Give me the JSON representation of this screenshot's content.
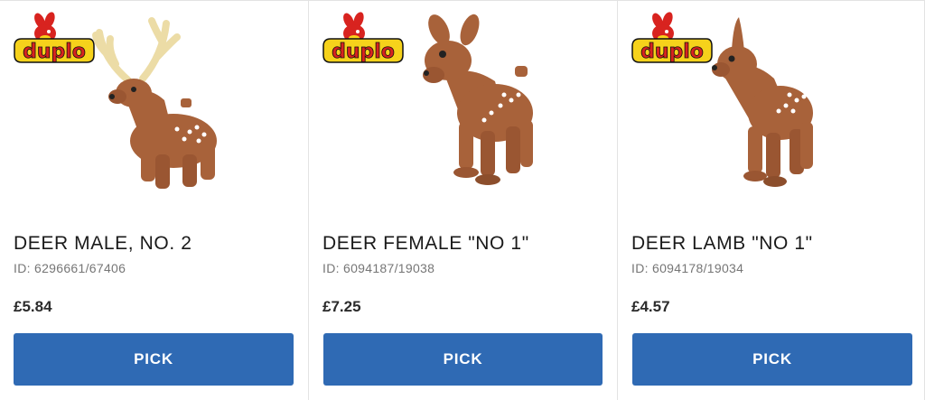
{
  "brand": {
    "logo_text": "duplo",
    "colors": {
      "logo_red": "#d8231f",
      "logo_yellow": "#f6d21b",
      "deer_brown": "#a8623a",
      "antler_cream": "#ecdca6",
      "button_blue": "#2f6ab4"
    }
  },
  "products": [
    {
      "name": "DEER MALE, NO. 2",
      "id": "ID: 6296661/67406",
      "price": "£5.84",
      "button_label": "PICK",
      "image_icon": "deer-male-icon"
    },
    {
      "name": "DEER FEMALE \"NO 1\"",
      "id": "ID: 6094187/19038",
      "price": "£7.25",
      "button_label": "PICK",
      "image_icon": "deer-female-icon"
    },
    {
      "name": "DEER LAMB \"NO 1\"",
      "id": "ID: 6094178/19034",
      "price": "£4.57",
      "button_label": "PICK",
      "image_icon": "deer-lamb-icon"
    }
  ]
}
